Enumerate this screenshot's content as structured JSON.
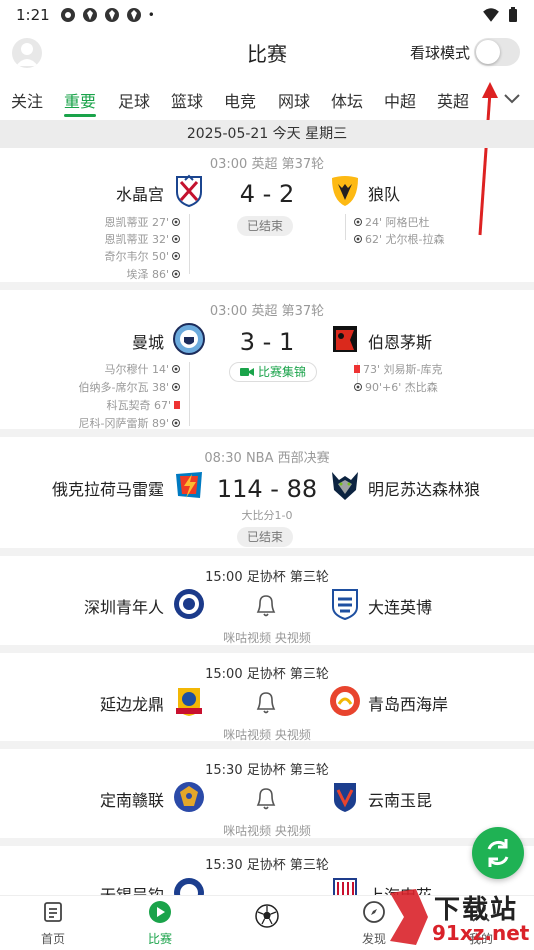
{
  "status": {
    "time": "1:21",
    "dot": "•"
  },
  "header": {
    "title": "比赛",
    "watch_mode_label": "看球模式",
    "watch_mode_on": false
  },
  "tabs": [
    "关注",
    "重要",
    "足球",
    "篮球",
    "电竞",
    "网球",
    "体坛",
    "中超",
    "英超"
  ],
  "active_tab": "重要",
  "date_band": "2025-05-21 今天 星期三",
  "matches": [
    {
      "meta": "03:00 英超 第37轮",
      "home": "水晶宫",
      "away": "狼队",
      "score": "4 - 2",
      "status": "已结束",
      "home_events": [
        "恩凯蒂亚 27'",
        "恩凯蒂亚 32'",
        "奇尔韦尔 50'",
        "埃泽 86'"
      ],
      "away_events": [
        "24' 阿格巴杜",
        "62' 尤尔根-拉森"
      ]
    },
    {
      "meta": "03:00 英超 第37轮",
      "home": "曼城",
      "away": "伯恩茅斯",
      "score": "3 - 1",
      "status": "比赛集锦",
      "home_events": [
        "马尔穆什 14'",
        "伯纳多-席尔瓦 38'",
        "科瓦契奇 67'",
        "尼科-冈萨雷斯 89'"
      ],
      "away_events": [
        "73' 刘易斯-库克",
        "90'+6' 杰比森"
      ]
    },
    {
      "meta": "08:30 NBA 西部决赛",
      "home": "俄克拉荷马雷霆",
      "away": "明尼苏达森林狼",
      "score": "114 - 88",
      "sub": "大比分1-0",
      "status": "已结束"
    },
    {
      "meta": "15:00 足协杯 第三轮",
      "home": "深圳青年人",
      "away": "大连英博",
      "channels": "咪咕视频 央视频"
    },
    {
      "meta": "15:00 足协杯 第三轮",
      "home": "延边龙鼎",
      "away": "青岛西海岸",
      "channels": "咪咕视频 央视频"
    },
    {
      "meta": "15:30 足协杯 第三轮",
      "home": "定南赣联",
      "away": "云南玉昆",
      "channels": "咪咕视频 央视频"
    },
    {
      "meta": "15:30 足协杯 第三轮",
      "home": "无锡吴钩",
      "away": "上海申花"
    }
  ],
  "bottom_nav": [
    "首页",
    "比赛",
    "",
    "发现",
    "我的"
  ],
  "watermark": {
    "title": "下载站",
    "domain": "91xz.net"
  },
  "colors": {
    "accent": "#1aa34a",
    "fab": "#1fb254",
    "red": "#e33333"
  }
}
